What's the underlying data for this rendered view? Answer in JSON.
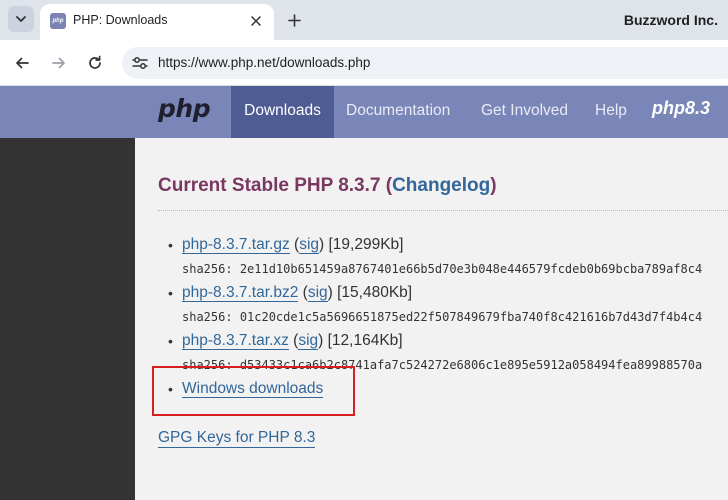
{
  "browser": {
    "tab": {
      "title": "PHP: Downloads",
      "favicon_text": "php"
    },
    "profile_name": "Buzzword Inc.",
    "address_bar": {
      "url": "https://www.php.net/downloads.php"
    }
  },
  "site_header": {
    "logo": "php",
    "nav": [
      {
        "label": "Downloads",
        "active": true
      },
      {
        "label": "Documentation",
        "active": false
      },
      {
        "label": "Get Involved",
        "active": false
      },
      {
        "label": "Help",
        "active": false
      }
    ],
    "promo_logo": "php8.3"
  },
  "main": {
    "release_title": "Current Stable PHP 8.3.7",
    "changelog_paren_open": " (",
    "changelog_label": "Changelog",
    "changelog_paren_close": ")",
    "downloads": [
      {
        "file": "php-8.3.7.tar.gz",
        "sig": "sig",
        "size": "[19,299Kb]",
        "sha_label": "sha256:",
        "sha": "2e11d10b651459a8767401e66b5d70e3b048e446579fcdeb0b69bcba789af8c4"
      },
      {
        "file": "php-8.3.7.tar.bz2",
        "sig": "sig",
        "size": "[15,480Kb]",
        "sha_label": "sha256:",
        "sha": "01c20cde1c5a5696651875ed22f507849679fba740f8c421616b7d43d7f4b4c4"
      },
      {
        "file": "php-8.3.7.tar.xz",
        "sig": "sig",
        "size": "[12,164Kb]",
        "sha_label": "sha256:",
        "sha": "d53433c1ca6b2c8741afa7c524272e6806c1e895e5912a058494fea89988570a"
      }
    ],
    "windows_downloads": "Windows downloads",
    "gpg_keys": "GPG Keys for PHP 8.3"
  },
  "colors": {
    "nav_bg": "#7a86b8",
    "nav_active": "#4f5b93",
    "link": "#336699",
    "title": "#793862",
    "annotation_box": "#d62020"
  }
}
